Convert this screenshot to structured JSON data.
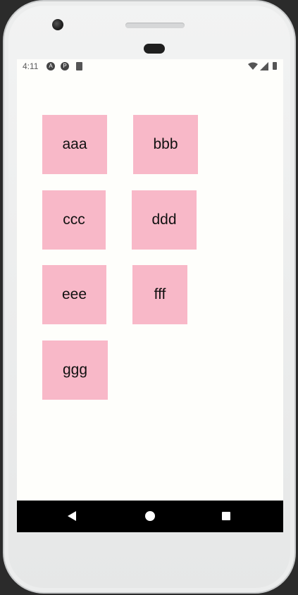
{
  "status_bar": {
    "time": "4:11",
    "icons": [
      "notification-a-icon",
      "notification-p-icon",
      "sd-card-icon",
      "wifi-icon",
      "signal-icon",
      "battery-icon"
    ]
  },
  "grid": {
    "items": [
      "aaa",
      "bbb",
      "ccc",
      "ddd",
      "eee",
      "fff",
      "ggg"
    ]
  },
  "nav_bar": {
    "icons": [
      "back-icon",
      "home-icon",
      "recents-icon"
    ]
  },
  "colors": {
    "tile": "#f8b8c8",
    "screen_bg": "#fefefb",
    "nav_bar": "#000000"
  }
}
